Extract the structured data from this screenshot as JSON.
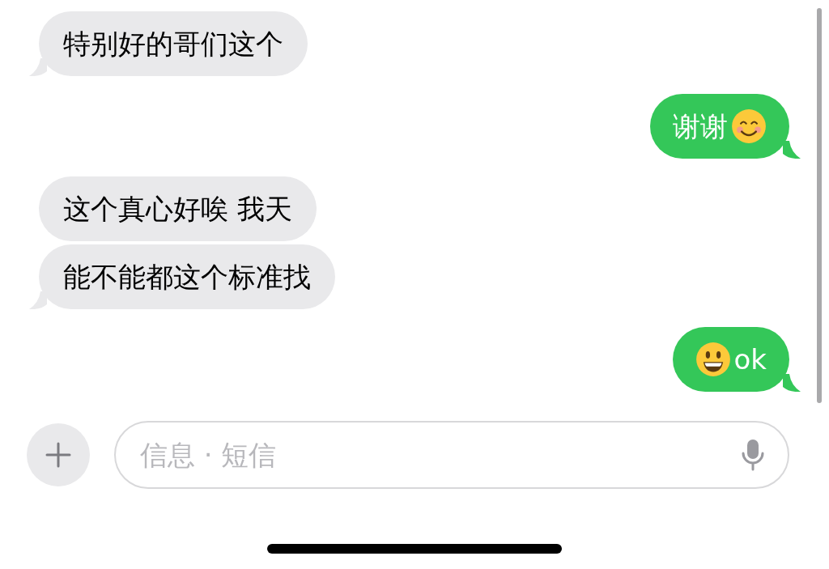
{
  "messages": [
    {
      "kind": "incoming",
      "tail": true,
      "parts": [
        {
          "kind": "text",
          "text": "特别好的哥们这个"
        }
      ]
    },
    {
      "kind": "outgoing",
      "tail": true,
      "parts": [
        {
          "kind": "text",
          "text": "谢谢"
        },
        {
          "kind": "smile"
        }
      ]
    },
    {
      "kind": "incoming",
      "tail": false,
      "parts": [
        {
          "kind": "text",
          "text": "这个真心好唉 我天"
        }
      ]
    },
    {
      "kind": "incoming",
      "tail": true,
      "parts": [
        {
          "kind": "text",
          "text": "能不能都这个标准找"
        }
      ]
    },
    {
      "kind": "outgoing",
      "tail": true,
      "parts": [
        {
          "kind": "grin"
        },
        {
          "kind": "text",
          "text": "ok"
        }
      ]
    }
  ],
  "composer": {
    "placeholder": "信息 · 短信"
  }
}
